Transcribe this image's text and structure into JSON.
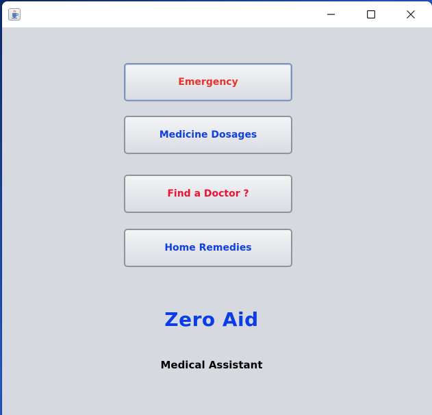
{
  "colors": {
    "red": "#e8332b",
    "blue": "#0f3fe0",
    "crimson": "#ee1131",
    "title_blue": "#0a3ce8"
  },
  "titlebar": {
    "app_icon": "java-cup-icon",
    "minimize_icon": "minimize-icon",
    "maximize_icon": "maximize-icon",
    "close_icon": "close-icon"
  },
  "buttons": {
    "emergency": "Emergency",
    "medicine_dosages": "Medicine Dosages",
    "find_doctor": "Find a Doctor ?",
    "home_remedies": "Home Remedies"
  },
  "app": {
    "title": "Zero Aid",
    "subtitle": "Medical Assistant"
  }
}
